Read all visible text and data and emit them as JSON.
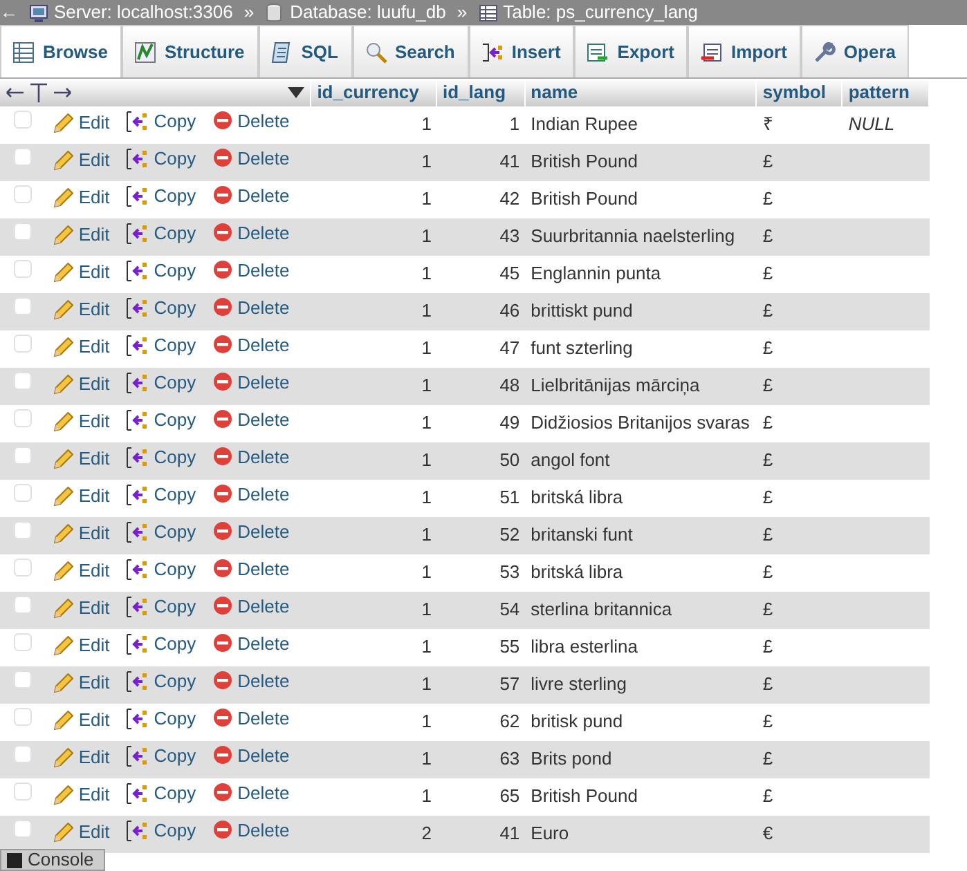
{
  "breadcrumb": [
    {
      "kind": "server",
      "label": "Server: localhost:3306"
    },
    {
      "kind": "database",
      "label": "Database: luufu_db"
    },
    {
      "kind": "table",
      "label": "Table: ps_currency_lang"
    }
  ],
  "breadcrumb_separator": "»",
  "back_arrow": "←",
  "tabs": [
    {
      "kind": "browse",
      "label": "Browse",
      "selected": true
    },
    {
      "kind": "structure",
      "label": "Structure",
      "selected": false
    },
    {
      "kind": "sql",
      "label": "SQL",
      "selected": false
    },
    {
      "kind": "search",
      "label": "Search",
      "selected": false
    },
    {
      "kind": "insert",
      "label": "Insert",
      "selected": false
    },
    {
      "kind": "export",
      "label": "Export",
      "selected": false
    },
    {
      "kind": "import",
      "label": "Import",
      "selected": false
    },
    {
      "kind": "operations",
      "label": "Opera",
      "selected": false
    }
  ],
  "table": {
    "columns": [
      "id_currency",
      "id_lang",
      "name",
      "symbol",
      "pattern"
    ],
    "rows": [
      {
        "checked": false,
        "actions": [
          "Edit",
          "Copy",
          "Delete"
        ],
        "cells": [
          "1",
          "1",
          "Indian Rupee",
          "₹",
          "NULL"
        ]
      },
      {
        "checked": false,
        "actions": [
          "Edit",
          "Copy",
          "Delete"
        ],
        "cells": [
          "1",
          "41",
          "British Pound",
          "£",
          ""
        ]
      },
      {
        "checked": false,
        "actions": [
          "Edit",
          "Copy",
          "Delete"
        ],
        "cells": [
          "1",
          "42",
          "British Pound",
          "£",
          ""
        ]
      },
      {
        "checked": false,
        "actions": [
          "Edit",
          "Copy",
          "Delete"
        ],
        "cells": [
          "1",
          "43",
          "Suurbritannia naelsterling",
          "£",
          ""
        ]
      },
      {
        "checked": false,
        "actions": [
          "Edit",
          "Copy",
          "Delete"
        ],
        "cells": [
          "1",
          "45",
          "Englannin punta",
          "£",
          ""
        ]
      },
      {
        "checked": false,
        "actions": [
          "Edit",
          "Copy",
          "Delete"
        ],
        "cells": [
          "1",
          "46",
          "brittiskt pund",
          "£",
          ""
        ]
      },
      {
        "checked": false,
        "actions": [
          "Edit",
          "Copy",
          "Delete"
        ],
        "cells": [
          "1",
          "47",
          "funt szterling",
          "£",
          ""
        ]
      },
      {
        "checked": false,
        "actions": [
          "Edit",
          "Copy",
          "Delete"
        ],
        "cells": [
          "1",
          "48",
          "Lielbritānijas mārciņa",
          "£",
          ""
        ]
      },
      {
        "checked": false,
        "actions": [
          "Edit",
          "Copy",
          "Delete"
        ],
        "cells": [
          "1",
          "49",
          "Didžiosios Britanijos svaras",
          "£",
          ""
        ]
      },
      {
        "checked": false,
        "actions": [
          "Edit",
          "Copy",
          "Delete"
        ],
        "cells": [
          "1",
          "50",
          "angol font",
          "£",
          ""
        ]
      },
      {
        "checked": false,
        "actions": [
          "Edit",
          "Copy",
          "Delete"
        ],
        "cells": [
          "1",
          "51",
          "britská libra",
          "£",
          ""
        ]
      },
      {
        "checked": false,
        "actions": [
          "Edit",
          "Copy",
          "Delete"
        ],
        "cells": [
          "1",
          "52",
          "britanski funt",
          "£",
          ""
        ]
      },
      {
        "checked": false,
        "actions": [
          "Edit",
          "Copy",
          "Delete"
        ],
        "cells": [
          "1",
          "53",
          "britská libra",
          "£",
          ""
        ]
      },
      {
        "checked": false,
        "actions": [
          "Edit",
          "Copy",
          "Delete"
        ],
        "cells": [
          "1",
          "54",
          "sterlina britannica",
          "£",
          ""
        ]
      },
      {
        "checked": false,
        "actions": [
          "Edit",
          "Copy",
          "Delete"
        ],
        "cells": [
          "1",
          "55",
          "libra esterlina",
          "£",
          ""
        ]
      },
      {
        "checked": false,
        "actions": [
          "Edit",
          "Copy",
          "Delete"
        ],
        "cells": [
          "1",
          "57",
          "livre sterling",
          "£",
          ""
        ]
      },
      {
        "checked": false,
        "actions": [
          "Edit",
          "Copy",
          "Delete"
        ],
        "cells": [
          "1",
          "62",
          "britisk pund",
          "£",
          ""
        ]
      },
      {
        "checked": false,
        "actions": [
          "Edit",
          "Copy",
          "Delete"
        ],
        "cells": [
          "1",
          "63",
          "Brits pond",
          "£",
          ""
        ]
      },
      {
        "checked": false,
        "actions": [
          "Edit",
          "Copy",
          "Delete"
        ],
        "cells": [
          "1",
          "65",
          "British Pound",
          "£",
          ""
        ]
      },
      {
        "checked": false,
        "actions": [
          "Edit",
          "Copy",
          "Delete"
        ],
        "cells": [
          "2",
          "41",
          "Euro",
          "€",
          ""
        ]
      }
    ]
  },
  "console": {
    "label": "Console"
  }
}
